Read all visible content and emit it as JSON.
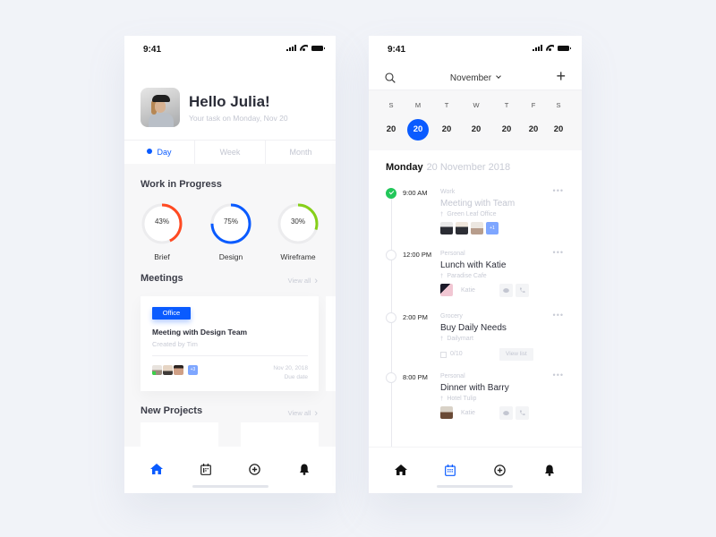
{
  "status_bar": {
    "time": "9:41"
  },
  "home": {
    "greeting": "Hello Julia!",
    "subtitle": "Your task on Monday, Nov 20",
    "tabs": [
      {
        "label": "Day",
        "active": true
      },
      {
        "label": "Week",
        "active": false
      },
      {
        "label": "Month",
        "active": false
      }
    ],
    "work_in_progress": {
      "title": "Work in Progress",
      "items": [
        {
          "label": "Brief",
          "percent": 43,
          "percent_text": "43%",
          "color": "#ff4a22"
        },
        {
          "label": "Design",
          "percent": 75,
          "percent_text": "75%",
          "color": "#0a5bff"
        },
        {
          "label": "Wireframe",
          "percent": 30,
          "percent_text": "30%",
          "color": "#86cf19"
        }
      ]
    },
    "meetings": {
      "title": "Meetings",
      "view_all": "View all",
      "card": {
        "badge": "Office",
        "title": "Meeting with Design Team",
        "created_by": "Created by Tim",
        "extra_count": "+3",
        "due_date": "Nov 20, 2018",
        "due_label": "Due date"
      }
    },
    "new_projects": {
      "title": "New Projects",
      "view_all": "View all"
    }
  },
  "tabbar": {
    "items": [
      {
        "name": "home",
        "icon": "home-icon"
      },
      {
        "name": "calendar",
        "icon": "calendar-icon"
      },
      {
        "name": "add",
        "icon": "add-circle-icon"
      },
      {
        "name": "notifications",
        "icon": "bell-icon"
      }
    ],
    "active_color": "#0a5bff"
  },
  "calendar": {
    "month": "November",
    "week": [
      {
        "day": "S",
        "date": "20",
        "selected": false
      },
      {
        "day": "M",
        "date": "20",
        "selected": true
      },
      {
        "day": "T",
        "date": "20",
        "selected": false
      },
      {
        "day": "W",
        "date": "20",
        "selected": false
      },
      {
        "day": "T",
        "date": "20",
        "selected": false
      },
      {
        "day": "F",
        "date": "20",
        "selected": false
      },
      {
        "day": "S",
        "date": "20",
        "selected": false
      }
    ],
    "day_name": "Monday",
    "full_date": "20 November 2018",
    "events": [
      {
        "time": "9:00 AM",
        "category": "Work",
        "title": "Meeting with Team",
        "location": "Green Leaf Office",
        "done": true,
        "extra_count": "+1"
      },
      {
        "time": "12:00 PM",
        "category": "Personal",
        "title": "Lunch with Katie",
        "location": "Paradise Cafe",
        "done": false,
        "person": "Katie"
      },
      {
        "time": "2:00 PM",
        "category": "Grocery",
        "title": "Buy Daily Needs",
        "location": "Dailymart",
        "done": false,
        "checklist": "0/10",
        "action": "View list"
      },
      {
        "time": "8:00 PM",
        "category": "Personal",
        "title": "Dinner with Barry",
        "location": "Hotel Tulip",
        "done": false,
        "person": "Katie"
      }
    ],
    "more_label": "•••"
  }
}
